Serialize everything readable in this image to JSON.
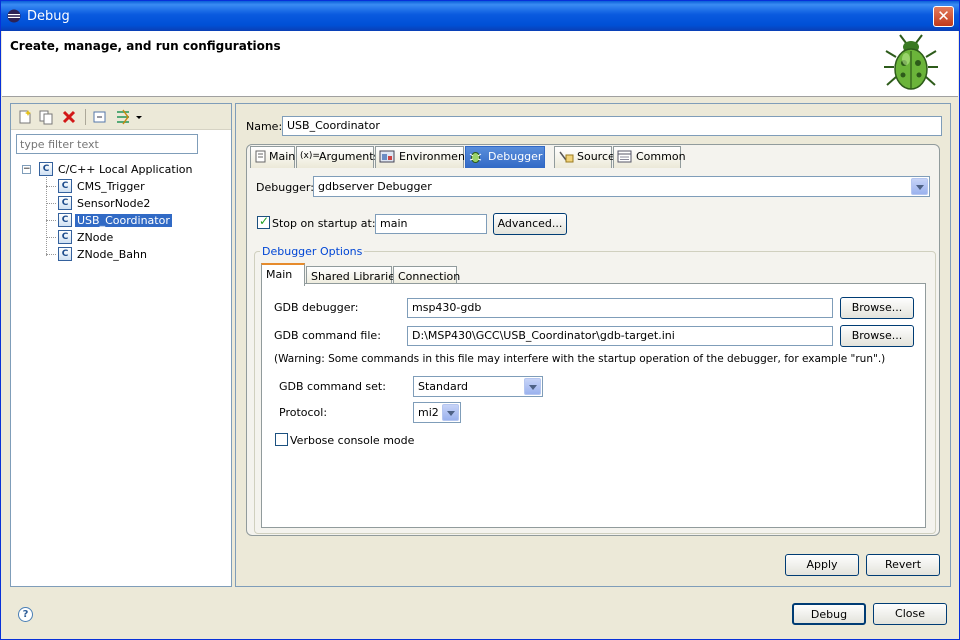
{
  "window": {
    "title": "Debug",
    "close_glyph": "✕"
  },
  "banner": {
    "heading": "Create, manage, and run configurations",
    "icon": "bug-icon"
  },
  "left": {
    "filter_placeholder": "type filter text",
    "tree": {
      "root": "C/C++ Local Application",
      "children": [
        "CMS_Trigger",
        "SensorNode2",
        "USB_Coordinator",
        "ZNode",
        "ZNode_Bahn"
      ],
      "selected": "USB_Coordinator"
    },
    "toolbar": [
      "new-config-icon",
      "duplicate-icon",
      "delete-icon",
      "collapse-all-icon",
      "filter-icon",
      "dropdown-icon"
    ]
  },
  "config": {
    "name_label": "Name:",
    "name_value": "USB_Coordinator",
    "tabs": [
      "Main",
      "Arguments",
      "Environment",
      "Debugger",
      "Source",
      "Common"
    ],
    "active_tab": "Debugger",
    "debugger_label": "Debugger:",
    "debugger_value": "gdbserver Debugger",
    "stop_on_startup_label": "Stop on startup at:",
    "stop_on_startup_checked": true,
    "stop_on_startup_value": "main",
    "advanced_button": "Advanced...",
    "options_group": "Debugger Options",
    "inner_tabs": [
      "Main",
      "Shared Libraries",
      "Connection"
    ],
    "inner_active": "Main",
    "gdb_debugger_label": "GDB debugger:",
    "gdb_debugger_value": "msp430-gdb",
    "browse_label": "Browse...",
    "gdb_command_file_label": "GDB command file:",
    "gdb_command_file_value": "D:\\MSP430\\GCC\\USB_Coordinator\\gdb-target.ini",
    "warning": "(Warning: Some commands in this file may interfere with the startup operation of the debugger, for example \"run\".)",
    "command_set_label": "GDB command set:",
    "command_set_value": "Standard",
    "protocol_label": "Protocol:",
    "protocol_value": "mi2",
    "verbose_label": "Verbose console mode",
    "verbose_checked": false,
    "apply_label": "Apply",
    "revert_label": "Revert"
  },
  "footer": {
    "debug_label": "Debug",
    "close_label": "Close",
    "help_glyph": "?"
  }
}
